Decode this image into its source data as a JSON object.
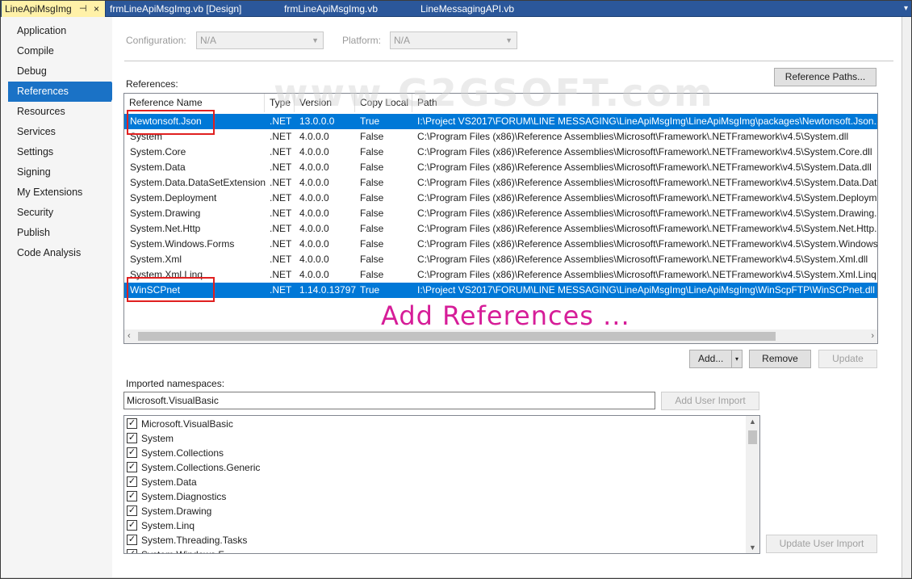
{
  "tabs": [
    {
      "label": "LineApiMsgImg",
      "pin": "⊣",
      "close": "×",
      "active": true
    },
    {
      "label": "frmLineApiMsgImg.vb [Design]",
      "active": false
    },
    {
      "label": "frmLineApiMsgImg.vb",
      "active": false
    },
    {
      "label": "LineMessagingAPI.vb",
      "active": false
    }
  ],
  "tab_dropdown": "▾",
  "sidebar": {
    "items": [
      {
        "label": "Application"
      },
      {
        "label": "Compile"
      },
      {
        "label": "Debug"
      },
      {
        "label": "References",
        "selected": true
      },
      {
        "label": "Resources"
      },
      {
        "label": "Services"
      },
      {
        "label": "Settings"
      },
      {
        "label": "Signing"
      },
      {
        "label": "My Extensions"
      },
      {
        "label": "Security"
      },
      {
        "label": "Publish"
      },
      {
        "label": "Code Analysis"
      }
    ]
  },
  "config": {
    "configuration_label": "Configuration:",
    "configuration_value": "N/A",
    "platform_label": "Platform:",
    "platform_value": "N/A"
  },
  "references": {
    "label": "References:",
    "paths_button": "Reference Paths...",
    "columns": [
      "Reference Name",
      "Type",
      "Version",
      "Copy Local",
      "Path"
    ],
    "rows": [
      {
        "name": "Newtonsoft.Json",
        "type": ".NET",
        "version": "13.0.0.0",
        "copy_local": "True",
        "path": "I:\\Project VS2017\\FORUM\\LINE MESSAGING\\LineApiMsgImg\\LineApiMsgImg\\packages\\Newtonsoft.Json.13",
        "selected": true
      },
      {
        "name": "System",
        "type": ".NET",
        "version": "4.0.0.0",
        "copy_local": "False",
        "path": "C:\\Program Files (x86)\\Reference Assemblies\\Microsoft\\Framework\\.NETFramework\\v4.5\\System.dll"
      },
      {
        "name": "System.Core",
        "type": ".NET",
        "version": "4.0.0.0",
        "copy_local": "False",
        "path": "C:\\Program Files (x86)\\Reference Assemblies\\Microsoft\\Framework\\.NETFramework\\v4.5\\System.Core.dll"
      },
      {
        "name": "System.Data",
        "type": ".NET",
        "version": "4.0.0.0",
        "copy_local": "False",
        "path": "C:\\Program Files (x86)\\Reference Assemblies\\Microsoft\\Framework\\.NETFramework\\v4.5\\System.Data.dll"
      },
      {
        "name": "System.Data.DataSetExtensions",
        "type": ".NET",
        "version": "4.0.0.0",
        "copy_local": "False",
        "path": "C:\\Program Files (x86)\\Reference Assemblies\\Microsoft\\Framework\\.NETFramework\\v4.5\\System.Data.DataS"
      },
      {
        "name": "System.Deployment",
        "type": ".NET",
        "version": "4.0.0.0",
        "copy_local": "False",
        "path": "C:\\Program Files (x86)\\Reference Assemblies\\Microsoft\\Framework\\.NETFramework\\v4.5\\System.Deployme"
      },
      {
        "name": "System.Drawing",
        "type": ".NET",
        "version": "4.0.0.0",
        "copy_local": "False",
        "path": "C:\\Program Files (x86)\\Reference Assemblies\\Microsoft\\Framework\\.NETFramework\\v4.5\\System.Drawing.d"
      },
      {
        "name": "System.Net.Http",
        "type": ".NET",
        "version": "4.0.0.0",
        "copy_local": "False",
        "path": "C:\\Program Files (x86)\\Reference Assemblies\\Microsoft\\Framework\\.NETFramework\\v4.5\\System.Net.Http.c"
      },
      {
        "name": "System.Windows.Forms",
        "type": ".NET",
        "version": "4.0.0.0",
        "copy_local": "False",
        "path": "C:\\Program Files (x86)\\Reference Assemblies\\Microsoft\\Framework\\.NETFramework\\v4.5\\System.Windows.l"
      },
      {
        "name": "System.Xml",
        "type": ".NET",
        "version": "4.0.0.0",
        "copy_local": "False",
        "path": "C:\\Program Files (x86)\\Reference Assemblies\\Microsoft\\Framework\\.NETFramework\\v4.5\\System.Xml.dll"
      },
      {
        "name": "System.Xml.Linq",
        "type": ".NET",
        "version": "4.0.0.0",
        "copy_local": "False",
        "path": "C:\\Program Files (x86)\\Reference Assemblies\\Microsoft\\Framework\\.NETFramework\\v4.5\\System.Xml.Linq.c"
      },
      {
        "name": "WinSCPnet",
        "type": ".NET",
        "version": "1.14.0.13797",
        "copy_local": "True",
        "path": "I:\\Project VS2017\\FORUM\\LINE MESSAGING\\LineApiMsgImg\\LineApiMsgImg\\WinScpFTP\\WinSCPnet.dll",
        "selected": true
      }
    ],
    "scroll_left": "‹",
    "scroll_right": "›"
  },
  "ref_buttons": {
    "add": "Add...",
    "add_dropdown": "▾",
    "remove": "Remove",
    "update": "Update"
  },
  "imported_namespaces": {
    "label": "Imported namespaces:",
    "input_value": "Microsoft.VisualBasic",
    "add_user_import": "Add User Import",
    "update_user_import": "Update User Import",
    "items": [
      {
        "label": "Microsoft.VisualBasic",
        "checked": true
      },
      {
        "label": "System",
        "checked": true
      },
      {
        "label": "System.Collections",
        "checked": true
      },
      {
        "label": "System.Collections.Generic",
        "checked": true
      },
      {
        "label": "System.Data",
        "checked": true
      },
      {
        "label": "System.Diagnostics",
        "checked": true
      },
      {
        "label": "System.Drawing",
        "checked": true
      },
      {
        "label": "System.Linq",
        "checked": true
      },
      {
        "label": "System.Threading.Tasks",
        "checked": true
      },
      {
        "label": "System.Windows.F",
        "checked": true
      }
    ],
    "scroll_up": "▲",
    "scroll_down": "▼"
  },
  "overlay": {
    "watermark": "www.G2GSOFT.com",
    "annotation": "Add References ..."
  },
  "colors": {
    "tab_bar": "#2b579a",
    "active_tab": "#fff1a8",
    "selection": "#0078d7",
    "sidebar_selected": "#1a72c6",
    "annotation": "#d61d98",
    "highlight_box": "#e02020"
  },
  "check_glyph": "✓"
}
